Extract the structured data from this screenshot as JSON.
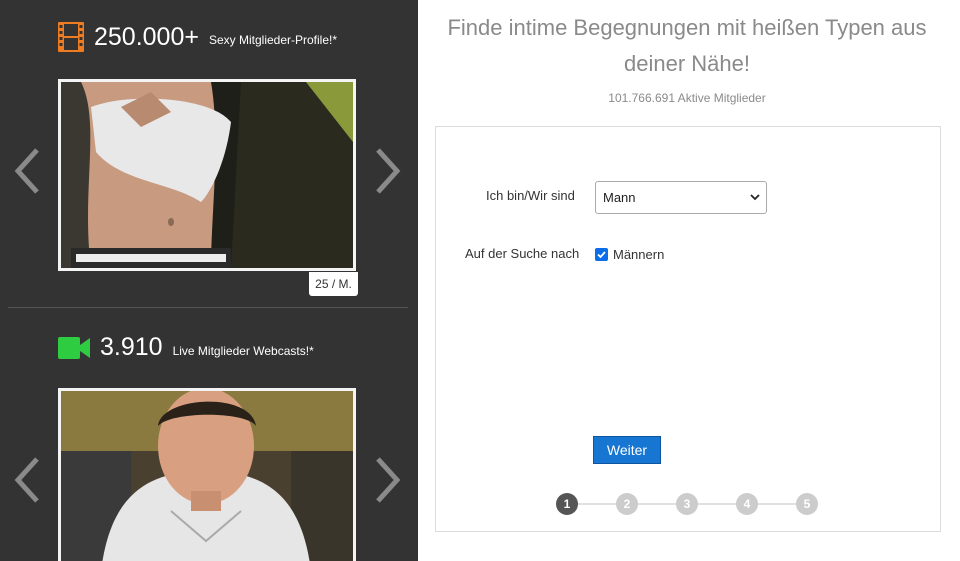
{
  "left_panel": {
    "profiles": {
      "count": "250.000+",
      "label": "Sexy Mitglieder-Profile!*",
      "icon": "film-icon",
      "icon_color": "#f07c22"
    },
    "webcams": {
      "count": "3.910",
      "label": "Live Mitglieder Webcasts!*",
      "icon": "video-camera-icon",
      "icon_color": "#2ecc40"
    },
    "profile_badge": "25 / M."
  },
  "signup": {
    "headline": "Finde intime Begegnungen mit heißen Typen aus deiner Nähe!",
    "active_members": "101.766.691 Aktive Mitglieder",
    "iam_label": "Ich bin/Wir sind",
    "iam_value": "Mann",
    "search_label": "Auf der Suche nach",
    "search_option": "Männern",
    "search_checked": true,
    "next_button": "Weiter",
    "steps": [
      "1",
      "2",
      "3",
      "4",
      "5"
    ],
    "active_step": 1,
    "accent_color": "#1776d1"
  }
}
